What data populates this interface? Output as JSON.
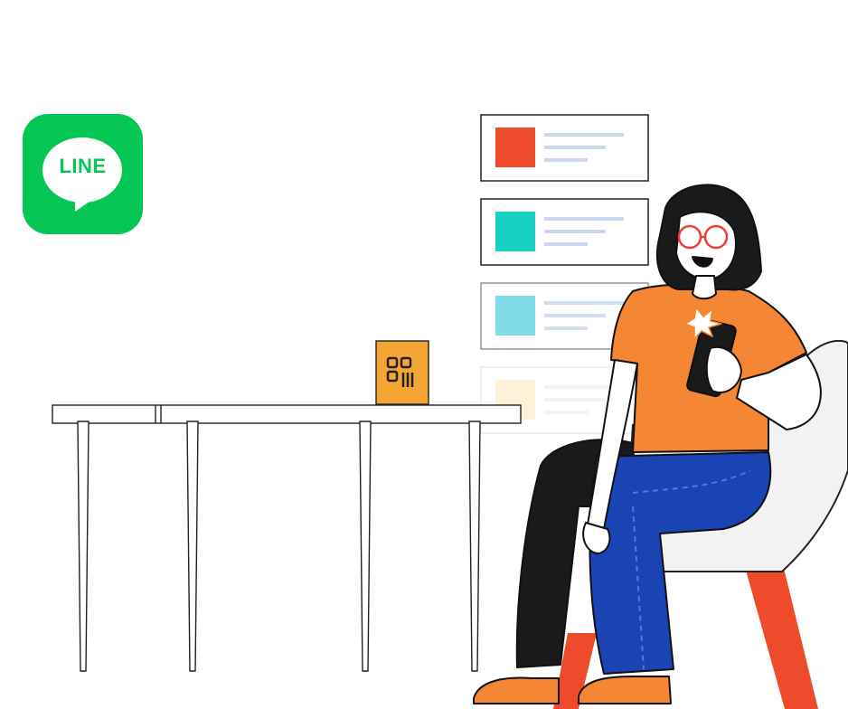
{
  "logo": {
    "text": "LINE",
    "icon": "line-logo-icon",
    "color": "#06c755"
  },
  "cards": [
    {
      "name": "content-card-1",
      "accent": "#f04a2c",
      "opacity": 1
    },
    {
      "name": "content-card-2",
      "accent": "#17d1c0",
      "opacity": 1
    },
    {
      "name": "content-card-3",
      "accent": "#6dd5e6",
      "opacity": 1
    },
    {
      "name": "content-card-4",
      "accent": "#fde7b8",
      "opacity": 0.6
    }
  ],
  "qr_stand": {
    "icon": "qr-code-icon",
    "color": "#f4a533"
  },
  "colors": {
    "shirt": "#f58633",
    "pants": "#1a43b3",
    "chair_leg": "#f04a2c",
    "glasses": "#ef3e36",
    "outline": "#111111"
  }
}
